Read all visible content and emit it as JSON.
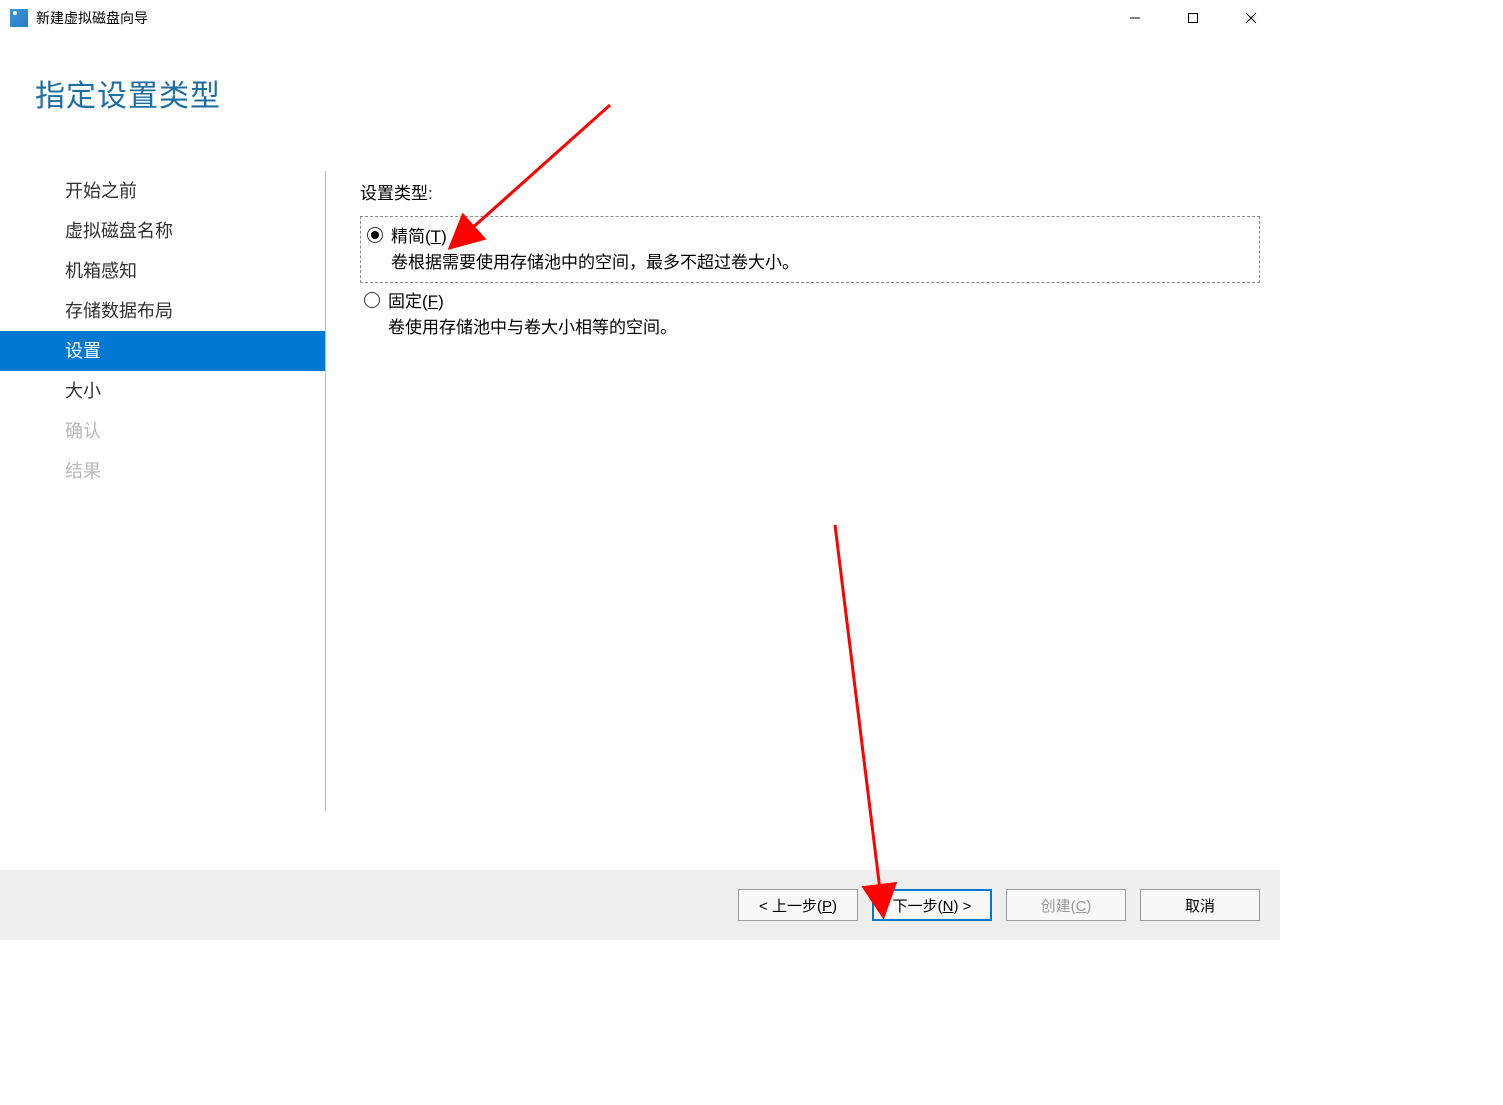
{
  "window": {
    "title": "新建虚拟磁盘向导"
  },
  "heading": "指定设置类型",
  "sidebar": {
    "items": [
      {
        "label": "开始之前",
        "state": "normal"
      },
      {
        "label": "虚拟磁盘名称",
        "state": "normal"
      },
      {
        "label": "机箱感知",
        "state": "normal"
      },
      {
        "label": "存储数据布局",
        "state": "normal"
      },
      {
        "label": "设置",
        "state": "active"
      },
      {
        "label": "大小",
        "state": "normal"
      },
      {
        "label": "确认",
        "state": "disabled"
      },
      {
        "label": "结果",
        "state": "disabled"
      }
    ]
  },
  "content": {
    "group_label": "设置类型:",
    "options": [
      {
        "title_pre": "精简(",
        "title_key": "T",
        "title_post": ")",
        "desc": "卷根据需要使用存储池中的空间，最多不超过卷大小。",
        "selected": true
      },
      {
        "title_pre": "固定(",
        "title_key": "F",
        "title_post": ")",
        "desc": "卷使用存储池中与卷大小相等的空间。",
        "selected": false
      }
    ]
  },
  "footer": {
    "prev_pre": "< 上一步(",
    "prev_key": "P",
    "prev_post": ")",
    "next_pre": "下一步(",
    "next_key": "N",
    "next_post": ") >",
    "create_pre": "创建(",
    "create_key": "C",
    "create_post": ")",
    "cancel": "取消"
  }
}
